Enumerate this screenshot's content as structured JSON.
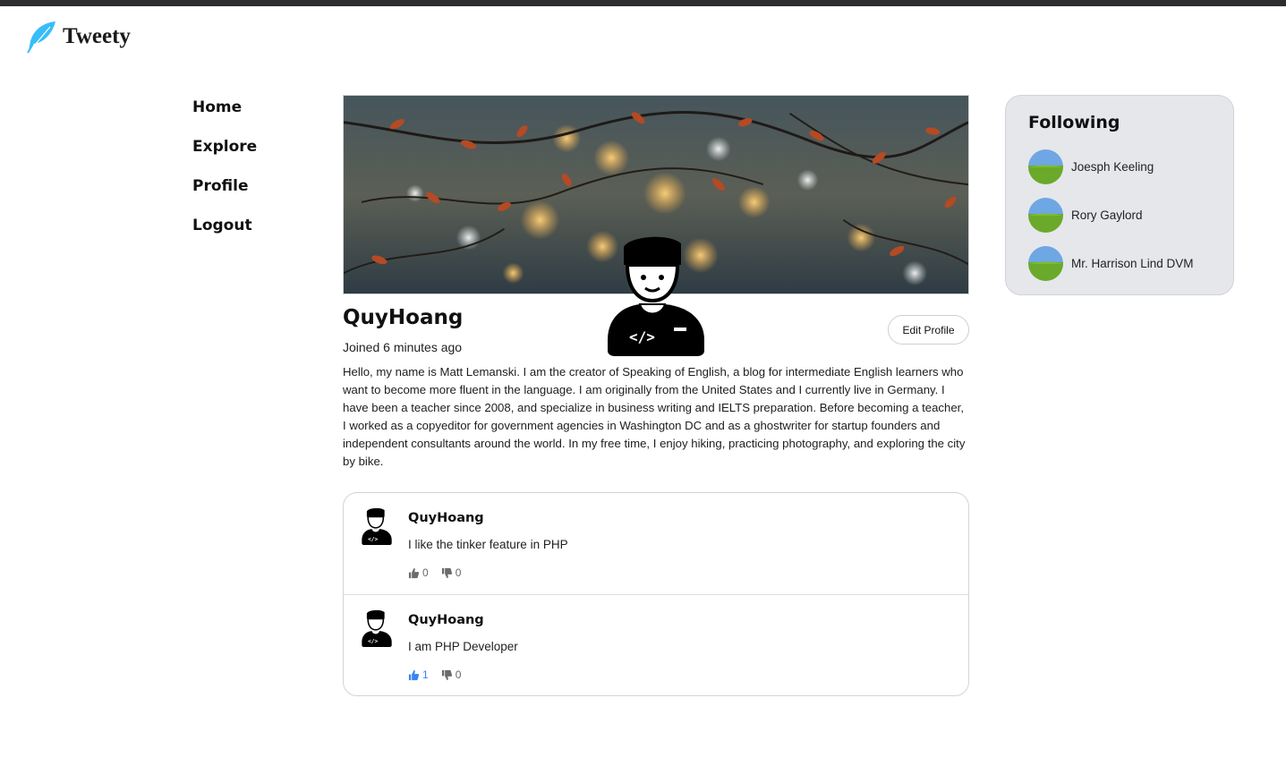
{
  "app": {
    "title": "Tweety"
  },
  "nav": {
    "items": [
      {
        "label": "Home"
      },
      {
        "label": "Explore"
      },
      {
        "label": "Profile"
      },
      {
        "label": "Logout"
      }
    ]
  },
  "profile": {
    "name": "QuyHoang",
    "joined": "Joined 6 minutes ago",
    "edit_label": "Edit Profile",
    "bio": "Hello, my name is Matt Lemanski. I am the creator of Speaking of English, a blog for intermediate English learners who want to become more fluent in the language. I am originally from the United States and I currently live in Germany. I have been a teacher since 2008, and specialize in business writing and IELTS preparation. Before becoming a teacher, I worked as a copyeditor for government agencies in Washington DC and as a ghostwriter for startup founders and independent consultants around the world. In my free time, I enjoy hiking, practicing photography, and exploring the city by bike."
  },
  "tweets": [
    {
      "author": "QuyHoang",
      "body": "I like the tinker feature in PHP",
      "likes": "0",
      "dislikes": "0",
      "liked": false
    },
    {
      "author": "QuyHoang",
      "body": "I am PHP Developer",
      "likes": "1",
      "dislikes": "0",
      "liked": true
    }
  ],
  "following": {
    "title": "Following",
    "users": [
      {
        "name": "Joesph Keeling"
      },
      {
        "name": "Rory Gaylord"
      },
      {
        "name": "Mr. Harrison Lind DVM"
      }
    ]
  },
  "icons": {
    "logo": "feather-icon",
    "like": "thumbs-up-icon",
    "dislike": "thumbs-down-icon",
    "avatar": "developer-avatar-icon"
  },
  "colors": {
    "accent": "#38bdf8",
    "liked": "#3b82f6",
    "panel": "#e5e7eb"
  }
}
